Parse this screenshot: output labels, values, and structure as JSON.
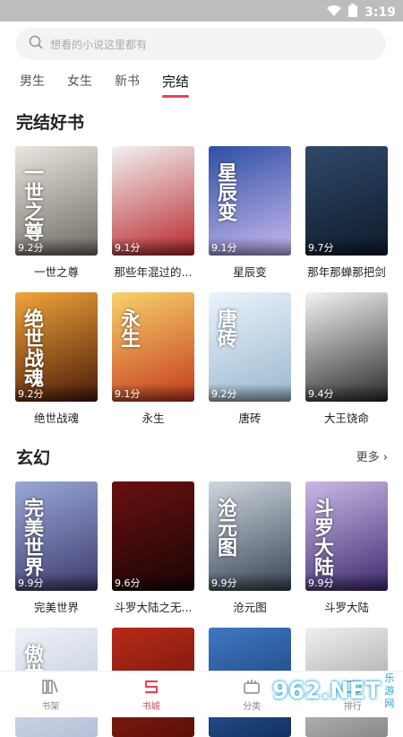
{
  "status": {
    "time": "3:19"
  },
  "search": {
    "placeholder": "想看的小说这里都有"
  },
  "tabs": [
    {
      "label": "男生",
      "active": false
    },
    {
      "label": "女生",
      "active": false
    },
    {
      "label": "新书",
      "active": false
    },
    {
      "label": "完结",
      "active": true
    }
  ],
  "section1": {
    "title": "完结好书",
    "books": [
      {
        "title": "一世之尊",
        "score": "9.2分",
        "cover_text": "一世之尊",
        "colors": [
          "#e9e6df",
          "#6f6a63"
        ]
      },
      {
        "title": "那些年混过的...",
        "score": "9.1分",
        "cover_text": "",
        "colors": [
          "#f2f2f2",
          "#b8262c"
        ]
      },
      {
        "title": "星辰变",
        "score": "9.1分",
        "cover_text": "星辰变",
        "colors": [
          "#2e4fa3",
          "#c9b9ef"
        ]
      },
      {
        "title": "那年那蝉那把剑",
        "score": "9.7分",
        "cover_text": "",
        "colors": [
          "#304a6a",
          "#0e1a2a"
        ]
      },
      {
        "title": "绝世战魂",
        "score": "9.2分",
        "cover_text": "绝世战魂",
        "colors": [
          "#f0a43a",
          "#4a1a08"
        ]
      },
      {
        "title": "永生",
        "score": "9.1分",
        "cover_text": "永生",
        "colors": [
          "#f7d26a",
          "#c53a1f"
        ]
      },
      {
        "title": "唐砖",
        "score": "9.2分",
        "cover_text": "唐砖",
        "colors": [
          "#eaf3fb",
          "#9ab8cf"
        ]
      },
      {
        "title": "大王饶命",
        "score": "9.4分",
        "cover_text": "",
        "colors": [
          "#f4f4f4",
          "#2b2b2b"
        ]
      }
    ]
  },
  "section2": {
    "title": "玄幻",
    "more": "更多",
    "books": [
      {
        "title": "完美世界",
        "score": "9.9分",
        "cover_text": "完美世界",
        "colors": [
          "#9aa7d6",
          "#3d3b6e"
        ]
      },
      {
        "title": "斗罗大陆之无...",
        "score": "9.6分",
        "cover_text": "",
        "colors": [
          "#6a1010",
          "#1a0505"
        ]
      },
      {
        "title": "沧元图",
        "score": "9.9分",
        "cover_text": "沧元图",
        "colors": [
          "#cfd7df",
          "#374454"
        ]
      },
      {
        "title": "斗罗大陆",
        "score": "9.9分",
        "cover_text": "斗罗大陆",
        "colors": [
          "#c9b9e6",
          "#402a70"
        ]
      },
      {
        "title": "",
        "score": "",
        "cover_text": "傲世九",
        "colors": [
          "#eef1f7",
          "#b6c0d8"
        ]
      },
      {
        "title": "",
        "score": "",
        "cover_text": "",
        "colors": [
          "#b72a18",
          "#5a1008"
        ]
      },
      {
        "title": "",
        "score": "",
        "cover_text": "",
        "colors": [
          "#3e78c4",
          "#123160"
        ]
      },
      {
        "title": "",
        "score": "",
        "cover_text": "",
        "colors": [
          "#f0f0f0",
          "#888888"
        ]
      }
    ]
  },
  "bottom_nav": [
    {
      "label": "书架",
      "icon": "bookshelf-icon",
      "active": false
    },
    {
      "label": "书城",
      "icon": "bookstore-icon",
      "active": true
    },
    {
      "label": "分类",
      "icon": "category-icon",
      "active": false
    },
    {
      "label": "排行",
      "icon": "ranking-icon",
      "active": false
    }
  ],
  "watermark": {
    "logo": "962.NET",
    "sub": "乐游网"
  },
  "accent": "#e64553"
}
